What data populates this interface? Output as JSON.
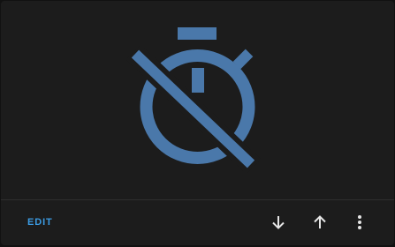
{
  "card": {
    "preview_icon": "timer-off-icon",
    "accent_color": "#4a78aa"
  },
  "actions": {
    "edit_label": "EDIT",
    "move_down_icon": "arrow-down-icon",
    "move_up_icon": "arrow-up-icon",
    "more_icon": "more-vertical-icon"
  }
}
